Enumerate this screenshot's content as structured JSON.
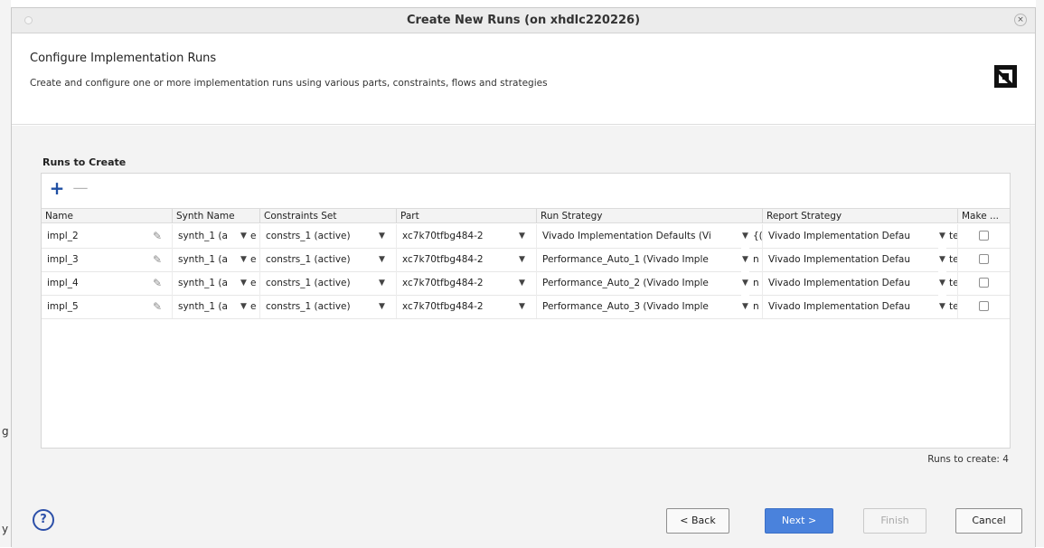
{
  "background": {
    "left_chars": [
      "g",
      "y"
    ]
  },
  "dialog": {
    "title": "Create New Runs (on xhdlc220226)",
    "close_glyph": "×"
  },
  "header": {
    "title": "Configure Implementation Runs",
    "subtitle": "Create and configure one or more implementation runs using various parts, constraints, flows and strategies",
    "logo_icon": "amd-logo-icon"
  },
  "section": {
    "label": "Runs to Create"
  },
  "toolbar": {
    "add_glyph": "+",
    "remove_glyph": "—"
  },
  "table": {
    "columns": [
      "Name",
      "Synth Name",
      "Constraints Set",
      "Part",
      "Run Strategy",
      "Report Strategy",
      "Make ..."
    ],
    "rows": [
      {
        "name": "impl_2",
        "synth": "synth_1 (a",
        "synth_tail": "e",
        "constraints": "constrs_1 (active)",
        "part": "xc7k70tfbg484-2",
        "run_strategy": "Vivado Implementation Defaults (Vi",
        "run_tail": "{(",
        "report_strategy": "Vivado Implementation Defau",
        "report_tail": "te",
        "make": false
      },
      {
        "name": "impl_3",
        "synth": "synth_1 (a",
        "synth_tail": "e",
        "constraints": "constrs_1 (active)",
        "part": "xc7k70tfbg484-2",
        "run_strategy": "Performance_Auto_1 (Vivado Imple",
        "run_tail": "n",
        "report_strategy": "Vivado Implementation Defau",
        "report_tail": "te",
        "make": false
      },
      {
        "name": "impl_4",
        "synth": "synth_1 (a",
        "synth_tail": "e",
        "constraints": "constrs_1 (active)",
        "part": "xc7k70tfbg484-2",
        "run_strategy": "Performance_Auto_2 (Vivado Imple",
        "run_tail": "n",
        "report_strategy": "Vivado Implementation Defau",
        "report_tail": "te",
        "make": false
      },
      {
        "name": "impl_5",
        "synth": "synth_1 (a",
        "synth_tail": "e",
        "constraints": "constrs_1 (active)",
        "part": "xc7k70tfbg484-2",
        "run_strategy": "Performance_Auto_3 (Vivado Imple",
        "run_tail": "n",
        "report_strategy": "Vivado Implementation Defau",
        "report_tail": "te",
        "make": false
      }
    ]
  },
  "footer": {
    "runs_count": "Runs to create: 4",
    "help_glyph": "?",
    "back_label": "< Back",
    "next_label": "Next >",
    "finish_label": "Finish",
    "cancel_label": "Cancel"
  },
  "colors": {
    "primary_button": "#4a82dc",
    "accent_blue": "#1f4fa3",
    "title_bar": "#ececec"
  }
}
